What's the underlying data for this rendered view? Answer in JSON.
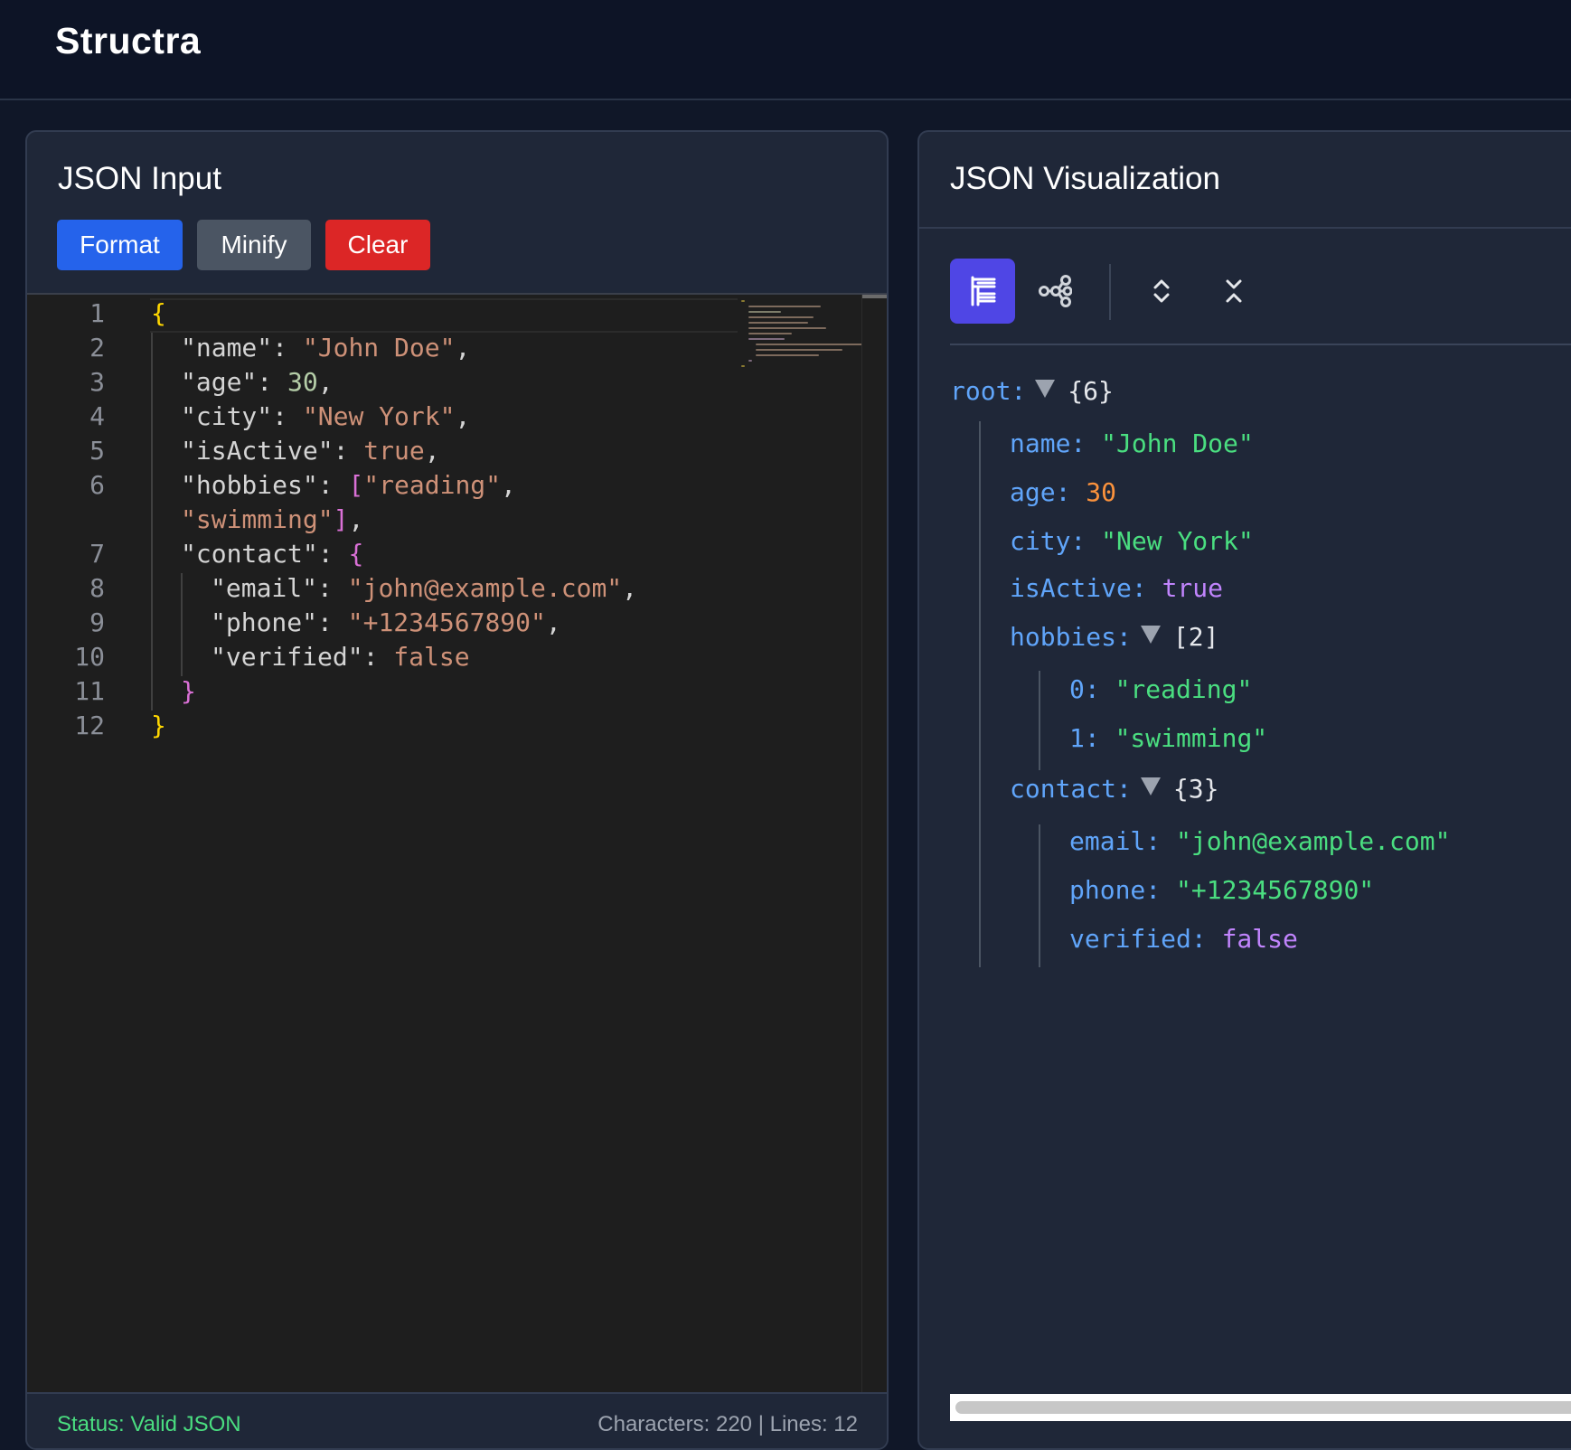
{
  "app": {
    "title": "Structra"
  },
  "input_panel": {
    "title": "JSON Input",
    "buttons": {
      "format": "Format",
      "minify": "Minify",
      "clear": "Clear"
    },
    "line_numbers": [
      "1",
      "2",
      "3",
      "4",
      "5",
      "6",
      "7",
      "8",
      "9",
      "10",
      "11",
      "12"
    ],
    "code": {
      "l1_open": "{",
      "l2_key": "\"name\"",
      "l2_val": "\"John Doe\"",
      "l3_key": "\"age\"",
      "l3_val": "30",
      "l4_key": "\"city\"",
      "l4_val": "\"New York\"",
      "l5_key": "\"isActive\"",
      "l5_val": "true",
      "l6_key": "\"hobbies\"",
      "l6_val1": "\"reading\"",
      "l6_val2": "\"swimming\"",
      "l7_key": "\"contact\"",
      "l8_key": "\"email\"",
      "l8_val": "\"john@example.com\"",
      "l9_key": "\"phone\"",
      "l9_val": "\"+1234567890\"",
      "l10_key": "\"verified\"",
      "l10_val": "false",
      "l11_close": "}",
      "l12_close": "}"
    },
    "status": "Status: Valid JSON",
    "stats": "Characters: 220 | Lines: 12"
  },
  "viz_panel": {
    "title": "JSON Visualization",
    "toolbar": {
      "tree_view_icon": "tree-list-icon",
      "graph_view_icon": "graph-nodes-icon",
      "expand_all_icon": "chevrons-expand-icon",
      "collapse_all_icon": "chevrons-collapse-icon"
    },
    "tree": {
      "root_key": "root:",
      "root_meta": "{6}",
      "name_key": "name:",
      "name_val": "\"John Doe\"",
      "age_key": "age:",
      "age_val": "30",
      "city_key": "city:",
      "city_val": "\"New York\"",
      "isActive_key": "isActive:",
      "isActive_val": "true",
      "hobbies_key": "hobbies:",
      "hobbies_meta": "[2]",
      "h0_key": "0:",
      "h0_val": "\"reading\"",
      "h1_key": "1:",
      "h1_val": "\"swimming\"",
      "contact_key": "contact:",
      "contact_meta": "{3}",
      "email_key": "email:",
      "email_val": "\"john@example.com\"",
      "phone_key": "phone:",
      "phone_val": "\"+1234567890\"",
      "verified_key": "verified:",
      "verified_val": "false"
    }
  },
  "colors": {
    "format_button": "#2563eb",
    "minify_button": "#4b5563",
    "clear_button": "#dc2626",
    "status_valid": "#4ade80",
    "active_tool": "#4f46e5"
  }
}
